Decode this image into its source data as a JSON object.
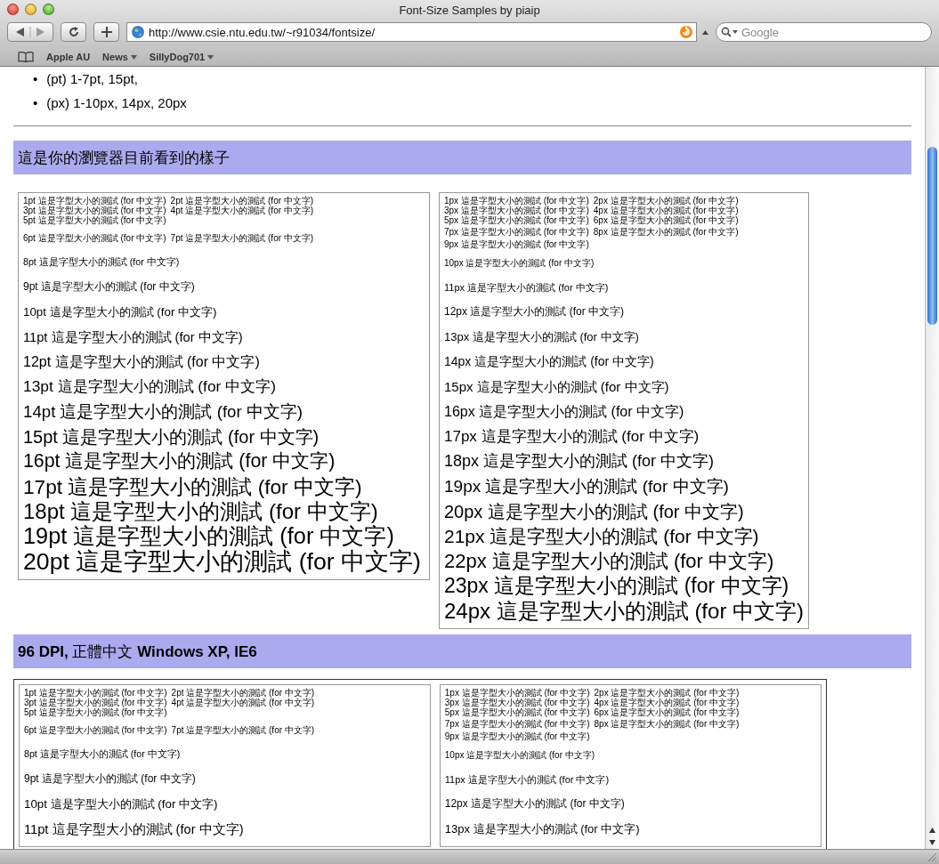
{
  "window": {
    "title": "Font-Size Samples by piaip"
  },
  "toolbar": {
    "url": "http://www.csie.ntu.edu.tw/~r91034/fontsize/",
    "search_placeholder": "Google"
  },
  "bookmarks": [
    {
      "label": "Apple AU",
      "menu": false
    },
    {
      "label": "News",
      "menu": true
    },
    {
      "label": "SillyDog701",
      "menu": true
    }
  ],
  "list": [
    {
      "marker": "•",
      "text": "(pt) 1-7pt, 15pt,"
    },
    {
      "marker": "•",
      "text": "(px) 1-10px, 14px, 20px"
    }
  ],
  "sections": [
    {
      "heading": [
        {
          "text": "這是你的瀏覽器目前看到的樣子",
          "bold": false
        }
      ],
      "framed": false,
      "boxes": [
        {
          "lines": [
            [
              "1pt 這是字型大小的測試 (for 中文字)",
              "2pt 這是字型大小的測試 (for 中文字)",
              "3pt 這是字型大小的測試 (for 中文字)",
              "4pt 這是字型大小的測試 (for 中文字)",
              "5pt 這是字型大小的測試 (for 中文字)"
            ],
            [
              "6pt 這是字型大小的測試 (for 中文字)",
              "7pt 這是字型大小的測試 (for 中文字)"
            ],
            [
              "8pt 這是字型大小的測試 (for 中文字)"
            ],
            [
              "9pt 這是字型大小的測試 (for 中文字)"
            ],
            [
              "10pt 這是字型大小的測試 (for 中文字)"
            ],
            [
              "11pt 這是字型大小的測試 (for 中文字)"
            ],
            [
              "12pt 這是字型大小的測試 (for 中文字)"
            ],
            [
              "13pt 這是字型大小的測試 (for 中文字)"
            ],
            [
              "14pt 這是字型大小的測試 (for 中文字)"
            ],
            [
              "15pt 這是字型大小的測試 (for 中文字)"
            ],
            [
              "16pt 這是字型大小的測試 (for 中文字)"
            ],
            [
              "17pt 這是字型大小的測試 (for 中文字)"
            ],
            [
              "18pt 這是字型大小的測試 (for 中文字)"
            ],
            [
              "19pt 這是字型大小的測試 (for 中文字)"
            ],
            [
              "20pt 這是字型大小的測試 (for 中文字)"
            ]
          ]
        },
        {
          "lines": [
            [
              "1px 這是字型大小的測試 (for 中文字)",
              "2px 這是字型大小的測試 (for 中文字)",
              "3px 這是字型大小的測試 (for 中文字)",
              "4px 這是字型大小的測試 (for 中文字)",
              "5px 這是字型大小的測試 (for 中文字)",
              "6px 這是字型大小的測試 (for 中文字)"
            ],
            [
              "7px 這是字型大小的測試 (for 中文字)",
              "8px 這是字型大小的測試 (for 中文字)",
              "9px 這是字型大小的測試 (for 中文字)"
            ],
            [
              "10px 這是字型大小的測試 (for 中文字)"
            ],
            [
              "11px 這是字型大小的測試 (for 中文字)"
            ],
            [
              "12px 這是字型大小的測試 (for 中文字)"
            ],
            [
              "13px 這是字型大小的測試 (for 中文字)"
            ],
            [
              "14px 這是字型大小的測試 (for 中文字)"
            ],
            [
              "15px 這是字型大小的測試 (for 中文字)"
            ],
            [
              "16px 這是字型大小的測試 (for 中文字)"
            ],
            [
              "17px 這是字型大小的測試 (for 中文字)"
            ],
            [
              "18px 這是字型大小的測試 (for 中文字)"
            ],
            [
              "19px 這是字型大小的測試 (for 中文字)"
            ],
            [
              "20px 這是字型大小的測試 (for 中文字)"
            ],
            [
              "21px 這是字型大小的測試 (for 中文字)"
            ],
            [
              "22px 這是字型大小的測試 (for 中文字)"
            ],
            [
              "23px 這是字型大小的測試 (for 中文字)"
            ],
            [
              "24px 這是字型大小的測試 (for 中文字)"
            ]
          ]
        }
      ]
    },
    {
      "heading": [
        {
          "text": "96 DPI,",
          "bold": true
        },
        {
          "text": "正體中文",
          "bold": false
        },
        {
          "text": "Windows XP, IE6",
          "bold": true
        }
      ],
      "framed": true,
      "boxes": [
        {
          "lines": [
            [
              "1pt 這是字型大小的測試 (for 中文字)",
              "2pt 這是字型大小的測試 (for 中文字)",
              "3pt 這是字型大小的測試 (for 中文字)",
              "4pt 這是字型大小的測試 (for 中文字)",
              "5pt 這是字型大小的測試 (for 中文字)"
            ],
            [
              "6pt 這是字型大小的測試 (for 中文字)",
              "7pt 這是字型大小的測試 (for 中文字)"
            ],
            [
              "8pt 這是字型大小的測試 (for 中文字)"
            ],
            [
              "9pt 這是字型大小的測試 (for 中文字)"
            ],
            [
              "10pt 這是字型大小的測試 (for 中文字)"
            ],
            [
              "11pt 這是字型大小的測試 (for 中文字)"
            ]
          ]
        },
        {
          "lines": [
            [
              "1px 這是字型大小的測試 (for 中文字)",
              "2px 這是字型大小的測試 (for 中文字)",
              "3px 這是字型大小的測試 (for 中文字)",
              "4px 這是字型大小的測試 (for 中文字)",
              "5px 這是字型大小的測試 (for 中文字)",
              "6px 這是字型大小的測試 (for 中文字)"
            ],
            [
              "7px 這是字型大小的測試 (for 中文字)",
              "8px 這是字型大小的測試 (for 中文字)",
              "9px 這是字型大小的測試 (for 中文字)"
            ],
            [
              "10px 這是字型大小的測試 (for 中文字)"
            ],
            [
              "11px 這是字型大小的測試 (for 中文字)"
            ],
            [
              "12px 這是字型大小的測試 (for 中文字)"
            ],
            [
              "13px 這是字型大小的測試 (for 中文字)"
            ]
          ]
        }
      ]
    }
  ]
}
